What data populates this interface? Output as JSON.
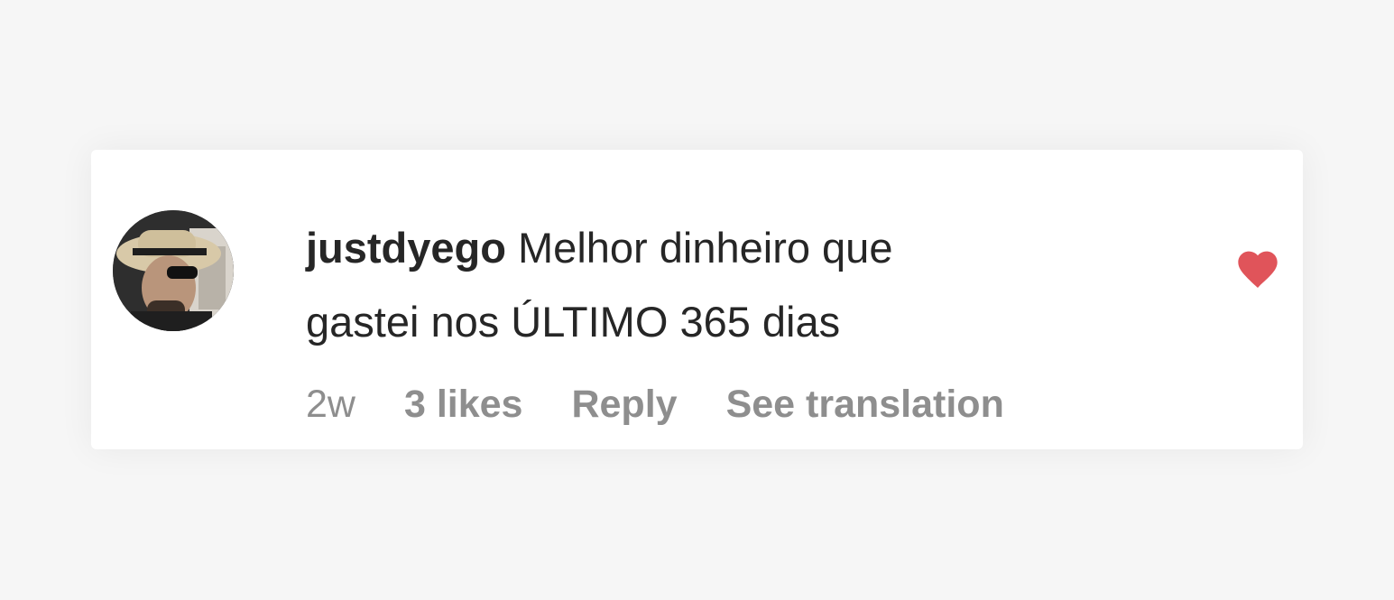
{
  "comment": {
    "username": "justdyego",
    "text_line1": "Melhor dinheiro que",
    "text_line2": "gastei nos ÚLTIMO 365 dias",
    "time": "2w",
    "likes": "3 likes",
    "reply_label": "Reply",
    "translate_label": "See translation",
    "liked": true,
    "heart_icon": "heart-icon",
    "heart_color": "#e0545a"
  }
}
